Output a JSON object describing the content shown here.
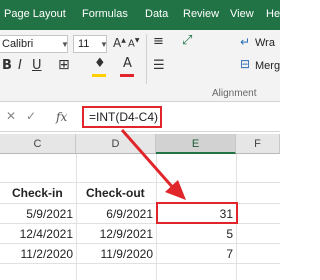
{
  "ribbon_tabs": [
    "Page Layout",
    "Formulas",
    "Data",
    "Review",
    "View",
    "Help"
  ],
  "font": {
    "name": "Calibri",
    "size": "11"
  },
  "ribbon": {
    "wrap_label": "Wra",
    "merge_label": "Merg",
    "alignment_group": "Alignment"
  },
  "formula_bar": {
    "fx_label": "fx",
    "formula": "=INT(D4-C4)"
  },
  "columns": [
    "C",
    "D",
    "E",
    "F"
  ],
  "table": {
    "headers": [
      "Check-in",
      "Check-out"
    ],
    "rows": [
      [
        "5/9/2021",
        "6/9/2021",
        "31"
      ],
      [
        "12/4/2021",
        "12/9/2021",
        "5"
      ],
      [
        "11/2/2020",
        "11/9/2020",
        "7"
      ]
    ]
  },
  "colors": {
    "excel_green": "#217346",
    "highlight_red": "#e0262b",
    "fill_yellow": "#ffd000",
    "font_red": "#e0262b"
  },
  "icons": [
    "font-dropdown-icon",
    "increase-font-icon",
    "decrease-font-icon",
    "align-icon",
    "wrap-text-icon",
    "bold-icon",
    "italic-icon",
    "underline-icon",
    "borders-icon",
    "fill-color-icon",
    "font-color-icon",
    "merge-icon",
    "fx-icon",
    "arrow-icon"
  ]
}
